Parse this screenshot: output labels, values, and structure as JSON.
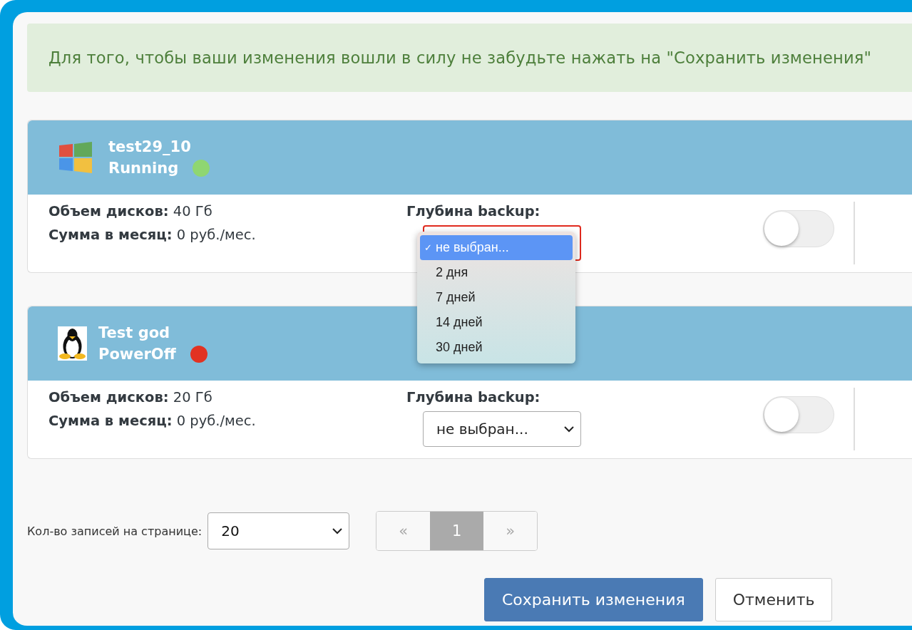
{
  "notice": "Для того, чтобы ваши изменения вошли в силу не забудьте нажать на \"Сохранить изменения\"",
  "servers": [
    {
      "kind": "windows",
      "name": "test29_10",
      "status": "Running",
      "color": "#8fd672",
      "disk_label": "Объем дисков:",
      "disk_value": "40 Гб",
      "price_label": "Сумма в месяц:",
      "price_value": "0 руб./мес.",
      "backup_label": "Глубина backup:",
      "backup_select": {
        "open": true,
        "check_mark": "✓",
        "options": [
          {
            "label": "не выбран...",
            "selected": true
          },
          {
            "label": "2 дня",
            "selected": false
          },
          {
            "label": "7 дней",
            "selected": false
          },
          {
            "label": "14 дней",
            "selected": false
          },
          {
            "label": "30 дней",
            "selected": false
          }
        ]
      },
      "toggle": {
        "on": false
      }
    },
    {
      "kind": "linux",
      "name": "Test god",
      "status": "PowerOff",
      "color": "#e23222",
      "disk_label": "Объем дисков:",
      "disk_value": "20 Гб",
      "price_label": "Сумма в месяц:",
      "price_value": "0 руб./мес.",
      "backup_label": "Глубина backup:",
      "backup_select": {
        "open": false,
        "value": "не выбран..."
      },
      "toggle": {
        "on": false
      }
    }
  ],
  "page_size": {
    "label": "Кол-во записей на странице:",
    "value": "20"
  },
  "pagination": [
    {
      "label": "«",
      "selected": false,
      "disabled": true
    },
    {
      "label": "1",
      "selected": true,
      "disabled": false
    },
    {
      "label": "»",
      "selected": false,
      "disabled": true
    }
  ],
  "buttons": [
    {
      "kind": "primary",
      "label": "Сохранить изменения"
    },
    {
      "kind": "default",
      "label": "Отменить"
    }
  ]
}
